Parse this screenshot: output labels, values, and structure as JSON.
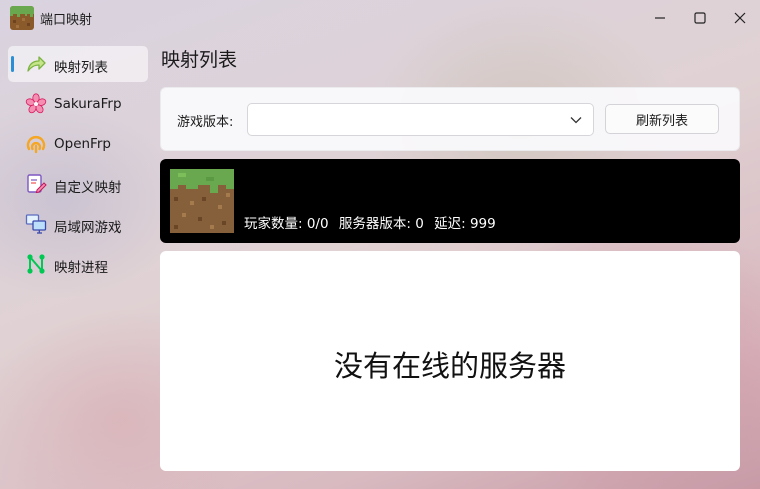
{
  "window": {
    "title": "端口映射",
    "app_icon": "grass-block-icon"
  },
  "sidebar": {
    "items": [
      {
        "label": "映射列表",
        "icon": "share-arrow-icon",
        "active": true
      },
      {
        "label": "SakuraFrp",
        "icon": "sakura-flower-icon",
        "active": false
      },
      {
        "label": "OpenFrp",
        "icon": "openfrp-logo-icon",
        "active": false
      },
      {
        "label": "自定义映射",
        "icon": "edit-document-icon",
        "active": false
      },
      {
        "label": "局域网游戏",
        "icon": "computers-icon",
        "active": false
      },
      {
        "label": "映射进程",
        "icon": "network-nodes-icon",
        "active": false
      }
    ]
  },
  "main": {
    "page_title": "映射列表",
    "version_label": "游戏版本:",
    "version_value": "",
    "refresh_label": "刷新列表",
    "server": {
      "players": "玩家数量: 0/0",
      "version": "服务器版本: 0",
      "latency": "延迟: 999"
    },
    "empty_message": "没有在线的服务器"
  },
  "colors": {
    "accent": "#2b8fd6",
    "server_card_bg": "#000000",
    "grass_green": "#6aa84f",
    "dirt_brown": "#8b5a2b"
  }
}
